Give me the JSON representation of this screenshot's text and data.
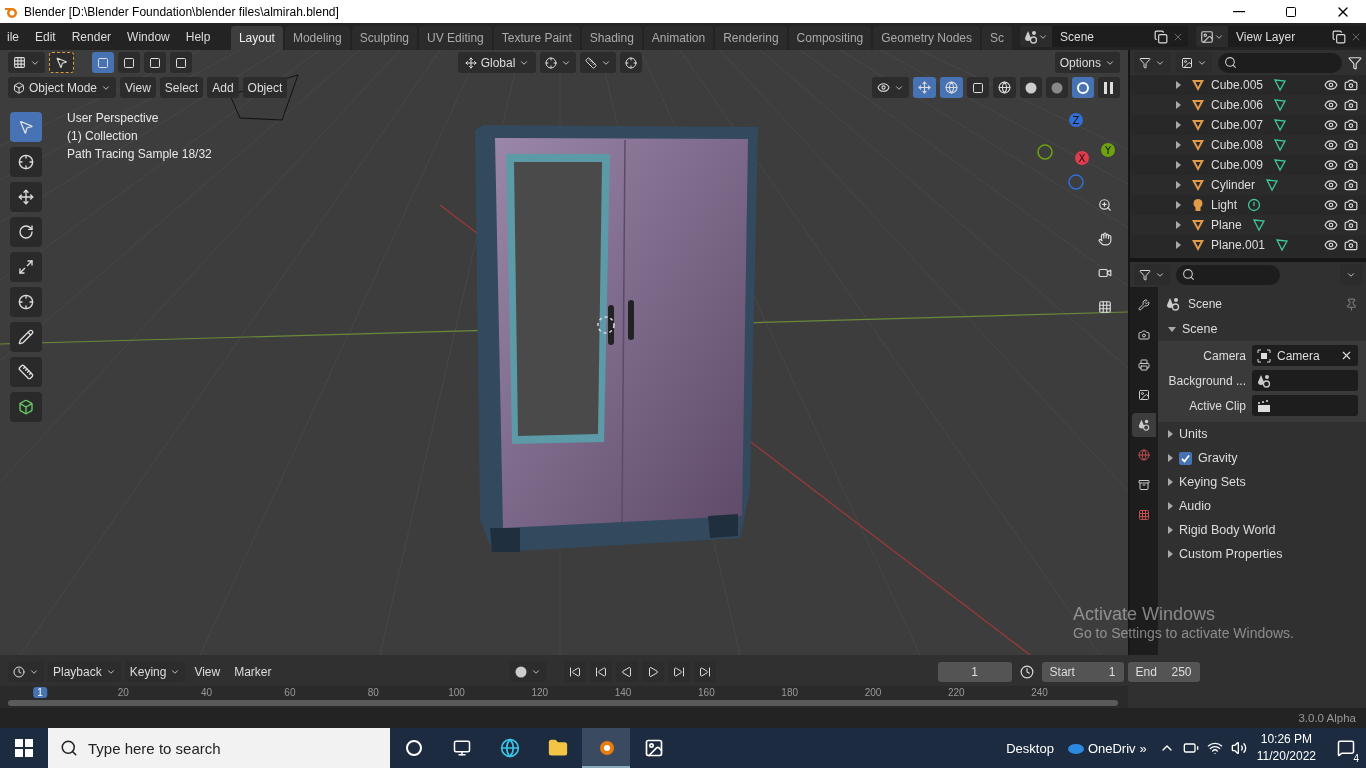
{
  "window": {
    "title": "Blender [D:\\Blender Foundation\\blender files\\almirah.blend]"
  },
  "menu": [
    "ile",
    "Edit",
    "Render",
    "Window",
    "Help"
  ],
  "workspaces": [
    {
      "label": "Layout",
      "selected": true
    },
    {
      "label": "Modeling",
      "selected": false
    },
    {
      "label": "Sculpting",
      "selected": false
    },
    {
      "label": "UV Editing",
      "selected": false
    },
    {
      "label": "Texture Paint",
      "selected": false
    },
    {
      "label": "Shading",
      "selected": false
    },
    {
      "label": "Animation",
      "selected": false
    },
    {
      "label": "Rendering",
      "selected": false
    },
    {
      "label": "Compositing",
      "selected": false
    },
    {
      "label": "Geometry Nodes",
      "selected": false
    },
    {
      "label": "Sc",
      "selected": false
    }
  ],
  "scene": "Scene",
  "view_layer": "View Layer",
  "viewport": {
    "orientation": "Global",
    "options": "Options",
    "mode": "Object Mode",
    "menus": [
      "View",
      "Select",
      "Add",
      "Object"
    ],
    "overlay": [
      "User Perspective",
      "(1) Collection",
      "Path Tracing Sample 18/32"
    ],
    "axes": [
      {
        "label": "Z",
        "color": "#2f6fd6"
      },
      {
        "label": "Y",
        "color": "#6ea30e"
      },
      {
        "label": "X",
        "color": "#e33b4e"
      }
    ]
  },
  "outliner": {
    "items": [
      {
        "name": "Cube.005",
        "kind": "mesh"
      },
      {
        "name": "Cube.006",
        "kind": "mesh"
      },
      {
        "name": "Cube.007",
        "kind": "mesh"
      },
      {
        "name": "Cube.008",
        "kind": "mesh"
      },
      {
        "name": "Cube.009",
        "kind": "mesh"
      },
      {
        "name": "Cylinder",
        "kind": "mesh"
      },
      {
        "name": "Light",
        "kind": "light"
      },
      {
        "name": "Plane",
        "kind": "mesh"
      },
      {
        "name": "Plane.001",
        "kind": "mesh"
      }
    ]
  },
  "properties": {
    "title": "Scene",
    "section": {
      "label": "Scene",
      "expanded": true,
      "fields": [
        {
          "label": "Camera",
          "value": "Camera",
          "kind": "camera"
        },
        {
          "label": "Background ...",
          "kind": "scene"
        },
        {
          "label": "Active Clip",
          "kind": "clip"
        }
      ]
    },
    "panels": [
      {
        "label": "Units",
        "kind": "panel",
        "expanded": false
      },
      {
        "label": "Gravity",
        "kind": "checkbox",
        "checked": true,
        "expanded": false
      },
      {
        "label": "Keying Sets",
        "kind": "panel",
        "expanded": false
      },
      {
        "label": "Audio",
        "kind": "panel",
        "expanded": false
      },
      {
        "label": "Rigid Body World",
        "kind": "panel",
        "expanded": false
      },
      {
        "label": "Custom Properties",
        "kind": "panel",
        "expanded": false
      }
    ]
  },
  "timeline": {
    "menus": [
      "Playback",
      "Keying",
      "View",
      "Marker"
    ],
    "current_frame": "1",
    "start_label": "Start",
    "start": "1",
    "end_label": "End",
    "end": "250",
    "ruler": [
      "1",
      "20",
      "40",
      "60",
      "80",
      "100",
      "120",
      "140",
      "160",
      "180",
      "200",
      "220",
      "240"
    ]
  },
  "status": "3.0.0 Alpha",
  "activation": {
    "title": "Activate Windows",
    "hint": "Go to Settings to activate Windows."
  },
  "taskbar": {
    "search_placeholder": "Type here to search",
    "desktop": "Desktop",
    "onedrive": "OneDriv",
    "chevron": "»",
    "time": "10:26 PM",
    "date": "11/20/2022",
    "notifications": "4"
  }
}
